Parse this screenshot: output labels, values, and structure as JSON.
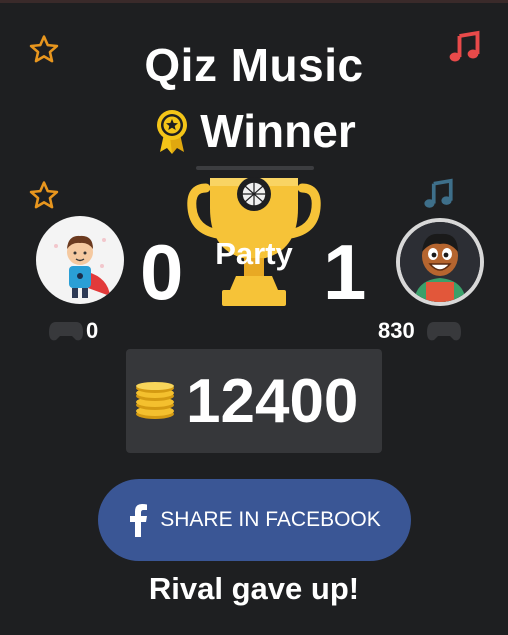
{
  "header": {
    "title": "Qiz Music",
    "result": "Winner"
  },
  "icons": {
    "star_color": "#e8961e",
    "music_note_color": "#e84a4a",
    "music_note_dim_color": "#3e6f8a",
    "medal_color": "#f4c518",
    "trophy_color": "#f6c338"
  },
  "match": {
    "category": "Party",
    "player": {
      "score": "0",
      "games": "0"
    },
    "rival": {
      "score": "1",
      "games": "830"
    }
  },
  "reward": {
    "coins": "12400"
  },
  "share": {
    "label": "SHARE IN FACEBOOK",
    "color": "#3a5695"
  },
  "status": {
    "message": "Rival gave up!"
  }
}
